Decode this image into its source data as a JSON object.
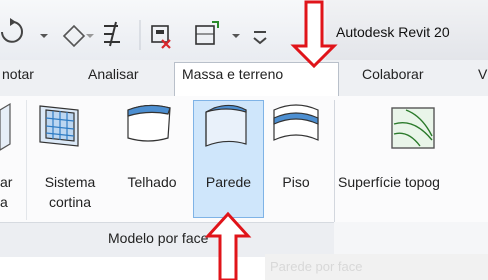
{
  "titlebar": {
    "title": "Autodesk Revit 20"
  },
  "tabs": [
    {
      "label": "notar"
    },
    {
      "label": "Analisar"
    },
    {
      "label": "Massa e terreno"
    },
    {
      "label": "Colaborar"
    },
    {
      "label": "V"
    }
  ],
  "tools": {
    "left_cut": {
      "line1": "ar",
      "line2": "a"
    },
    "sistema": {
      "line1": "Sistema",
      "line2": "cortina"
    },
    "telhado": {
      "label": "Telhado"
    },
    "parede": {
      "label": "Parede"
    },
    "piso": {
      "label": "Piso"
    },
    "superficie": {
      "label": "Superfície topog"
    }
  },
  "panel": {
    "label": "Modelo por face"
  },
  "tooltip": {
    "text": "Parede por face"
  },
  "colors": {
    "arrow": "#e0141a",
    "highlight": "#cfe6fb",
    "icon_blue": "#2f7cc4"
  }
}
